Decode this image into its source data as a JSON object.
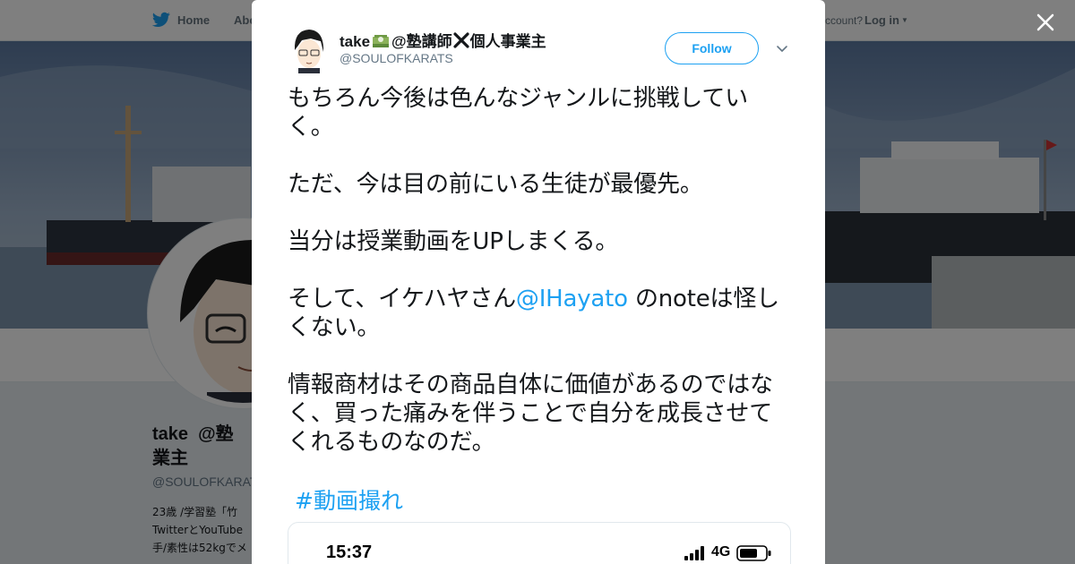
{
  "topbar": {
    "home_label": "Home",
    "about_label": "Abo",
    "account_prompt": "ccount?",
    "login_label": "Log in"
  },
  "profile": {
    "name": "take💴@塾講師❌個人事業主",
    "name_visible": "take  @塾\n業主",
    "handle": "@SOULOFKARAT",
    "bio_lines": "23歳 /学習塾「竹\nTwitterとYouTube\n手/素性は52kgでメ"
  },
  "tweet": {
    "author_name_pre": "take",
    "author_name_post": "@塾講師",
    "author_name_tail": "個人事業主",
    "author_handle": "@SOULOFKARATS",
    "follow_label": "Follow",
    "paragraphs": {
      "p1": "もちろん今後は色んなジャンルに挑戦していく。",
      "p2": "ただ、今は目の前にいる生徒が最優先。",
      "p3": "当分は授業動画をUPしまくる。",
      "p4_pre": "そして、イケハヤさん",
      "p4_mention": "@IHayato",
      "p4_post": " のnoteは怪しくない。",
      "p5": "情報商材はその商品自体に価値があるのではなく、買った痛みを伴うことで自分を成長させてくれるものなのだ。"
    },
    "hashtag": "#動画撮れ",
    "media": {
      "time": "15:37",
      "network": "4G"
    }
  },
  "colors": {
    "accent": "#1da1f2",
    "text": "#14171a",
    "secondary": "#657786",
    "overlay": "rgba(0,0,0,0.5)"
  },
  "icons": {
    "home": "twitter-bird-icon",
    "close": "close-icon",
    "caret": "chevron-down-icon",
    "signal": "signal-bars-icon",
    "battery": "battery-icon"
  }
}
